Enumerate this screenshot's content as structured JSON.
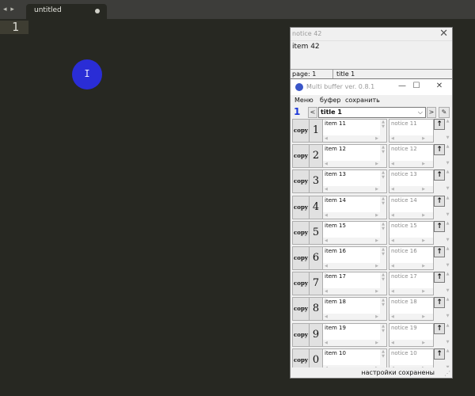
{
  "editor": {
    "nav_arrows": "◂ ▸",
    "tab_title": "untitled",
    "line_number": "1"
  },
  "notice_window": {
    "title": "notice 42",
    "close_icon": "✕",
    "content": "item 42",
    "status_page": "page: 1",
    "status_title": "title 1"
  },
  "multi_buffer": {
    "title": "Multi buffer ver. 0.8.1",
    "minimize_icon": "—",
    "maximize_icon": "☐",
    "close_icon": "✕",
    "menu": [
      "Меню",
      "буфер",
      "сохранить"
    ],
    "page_number": "1",
    "prev_label": "<",
    "next_label": ">",
    "select_value": "title 1",
    "select_chevron": "⌵",
    "edit_icon": "✎",
    "copy_label": "copy",
    "up_label": "↑",
    "rows": [
      {
        "num": "1",
        "item": "item 11",
        "notice": "notice 11"
      },
      {
        "num": "2",
        "item": "item 12",
        "notice": "notice 12"
      },
      {
        "num": "3",
        "item": "item 13",
        "notice": "notice 13"
      },
      {
        "num": "4",
        "item": "item 14",
        "notice": "notice 14"
      },
      {
        "num": "5",
        "item": "item 15",
        "notice": "notice 15"
      },
      {
        "num": "6",
        "item": "item 16",
        "notice": "notice 16"
      },
      {
        "num": "7",
        "item": "item 17",
        "notice": "notice 17"
      },
      {
        "num": "8",
        "item": "item 18",
        "notice": "notice 18"
      },
      {
        "num": "9",
        "item": "item 19",
        "notice": "notice 19"
      },
      {
        "num": "0",
        "item": "item 10",
        "notice": "notice 10"
      }
    ],
    "status_text": "настройки сохранены"
  }
}
